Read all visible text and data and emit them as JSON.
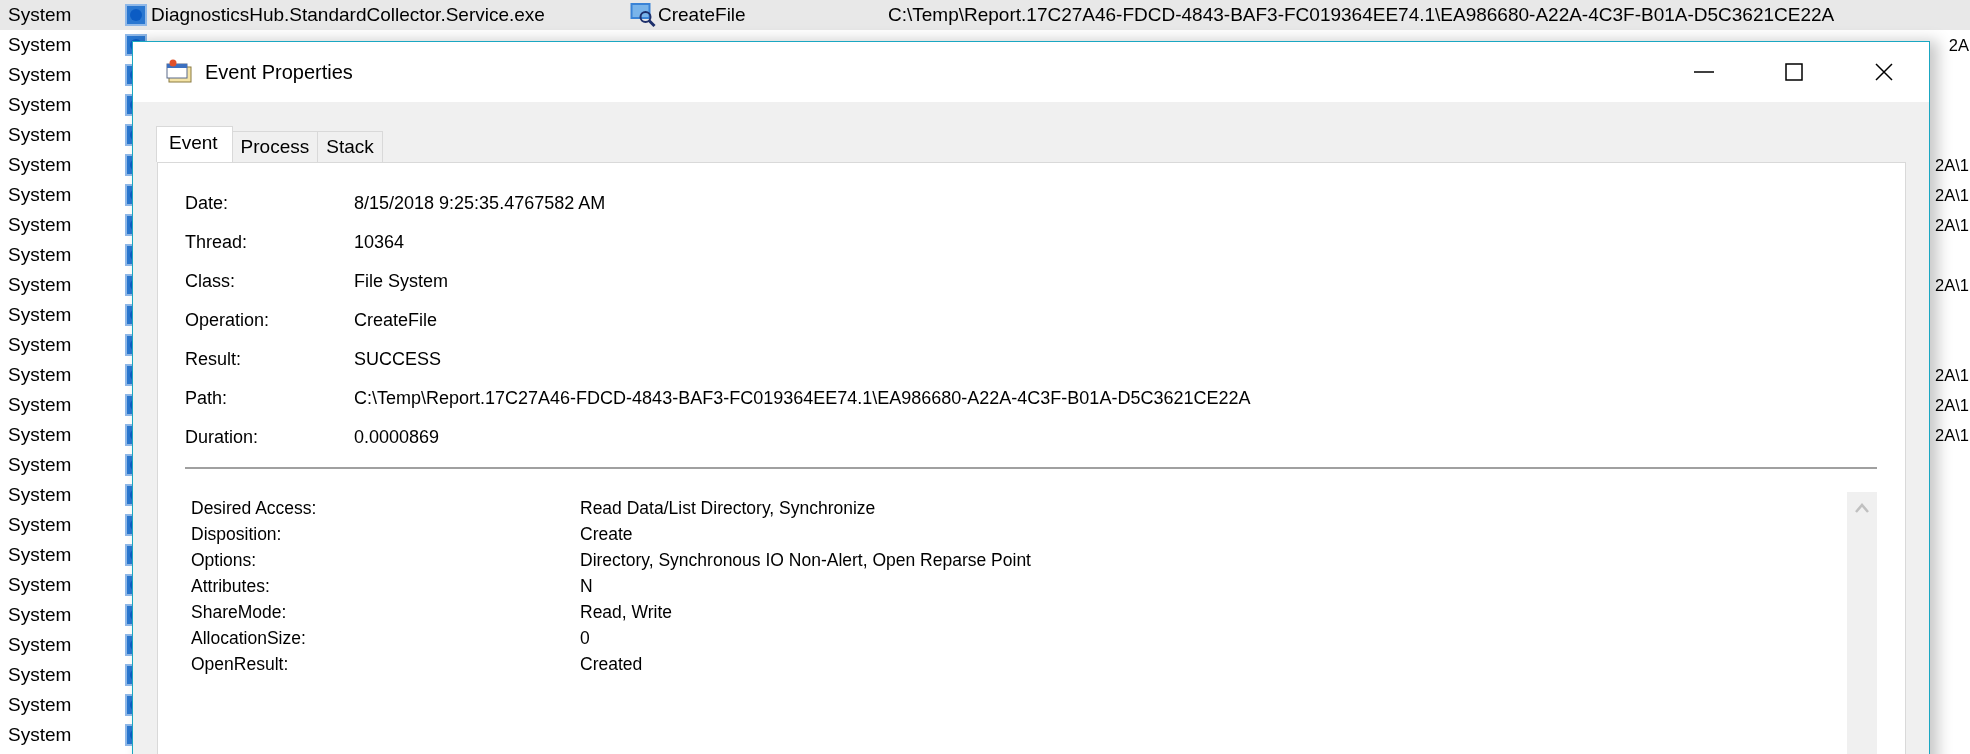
{
  "background_list": {
    "rows": [
      {
        "column_1": "System",
        "column_2": "DiagnosticsHub.StandardCollector.Service.exe",
        "column_3": "CreateFile",
        "column_4": "C:\\Temp\\Report.17C27A46-FDCD-4843-BAF3-FC019364EE74.1\\EA986680-A22A-4C3F-B01A-D5C3621CE22A",
        "selected": true
      },
      {
        "column_1": "System",
        "column_4": "2A",
        "selected": false
      },
      {
        "column_1": "System",
        "selected": false
      },
      {
        "column_1": "System",
        "selected": false
      },
      {
        "column_1": "System",
        "selected": false
      },
      {
        "column_1": "System",
        "column_4": "2A\\1",
        "selected": false
      },
      {
        "column_1": "System",
        "column_4": "2A\\1",
        "selected": false
      },
      {
        "column_1": "System",
        "column_4": "2A\\1",
        "selected": false
      },
      {
        "column_1": "System",
        "selected": false
      },
      {
        "column_1": "System",
        "column_4": "2A\\1",
        "selected": false
      },
      {
        "column_1": "System",
        "selected": false
      },
      {
        "column_1": "System",
        "selected": false
      },
      {
        "column_1": "System",
        "column_4": "2A\\1",
        "selected": false
      },
      {
        "column_1": "System",
        "column_4": "2A\\1",
        "selected": false
      },
      {
        "column_1": "System",
        "column_4": "2A\\1",
        "selected": false
      },
      {
        "column_1": "System",
        "selected": false
      },
      {
        "column_1": "System",
        "selected": false
      },
      {
        "column_1": "System",
        "selected": false
      },
      {
        "column_1": "System",
        "selected": false
      },
      {
        "column_1": "System",
        "selected": false
      },
      {
        "column_1": "System",
        "selected": false
      },
      {
        "column_1": "System",
        "selected": false
      },
      {
        "column_1": "System",
        "selected": false
      },
      {
        "column_1": "System",
        "selected": false
      },
      {
        "column_1": "System",
        "selected": false
      }
    ]
  },
  "dialog": {
    "title": "Event Properties",
    "tabs": [
      {
        "label": "Event",
        "selected": true
      },
      {
        "label": "Process",
        "selected": false
      },
      {
        "label": "Stack",
        "selected": false
      }
    ],
    "fields": [
      {
        "label": "Date:",
        "value": "8/15/2018 9:25:35.4767582 AM"
      },
      {
        "label": "Thread:",
        "value": "10364"
      },
      {
        "label": "Class:",
        "value": "File System"
      },
      {
        "label": "Operation:",
        "value": "CreateFile"
      },
      {
        "label": "Result:",
        "value": "SUCCESS"
      },
      {
        "label": "Path:",
        "value": "C:\\Temp\\Report.17C27A46-FDCD-4843-BAF3-FC019364EE74.1\\EA986680-A22A-4C3F-B01A-D5C3621CE22A"
      },
      {
        "label": "Duration:",
        "value": "0.0000869"
      }
    ],
    "details": [
      {
        "label": "Desired Access:",
        "value": "Read Data/List Directory, Synchronize"
      },
      {
        "label": "Disposition:",
        "value": "Create"
      },
      {
        "label": "Options:",
        "value": "Directory, Synchronous IO Non-Alert, Open Reparse Point"
      },
      {
        "label": "Attributes:",
        "value": "N"
      },
      {
        "label": "ShareMode:",
        "value": "Read, Write"
      },
      {
        "label": "AllocationSize:",
        "value": "0"
      },
      {
        "label": "OpenResult:",
        "value": "Created"
      }
    ]
  }
}
